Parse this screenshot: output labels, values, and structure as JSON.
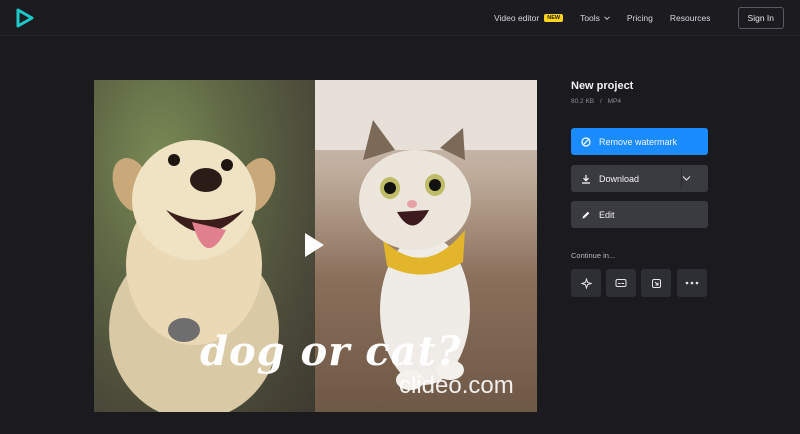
{
  "header": {
    "logo_icon": "play-logo-icon",
    "nav": {
      "video_editor": "Video editor",
      "new_badge": "NEW",
      "tools": "Tools",
      "pricing": "Pricing",
      "resources": "Resources",
      "sign_in": "Sign In"
    }
  },
  "preview": {
    "caption": "dog or cat?",
    "watermark": "clideo.com",
    "play_icon": "play-icon"
  },
  "project": {
    "title": "New project",
    "size": "80.2 KB",
    "separator": "/",
    "format": "MP4"
  },
  "actions": {
    "remove_watermark": "Remove watermark",
    "download": "Download",
    "edit": "Edit"
  },
  "continue": {
    "label": "Continue in...",
    "tiles": [
      "sparkle-icon",
      "subtitles-icon",
      "resize-icon",
      "more-icon"
    ]
  },
  "colors": {
    "background": "#1a1a1f",
    "accent": "#1a8cff",
    "badge": "#ffd21e",
    "button_dark": "#3a3a41",
    "logo": "#1ec8c8"
  }
}
